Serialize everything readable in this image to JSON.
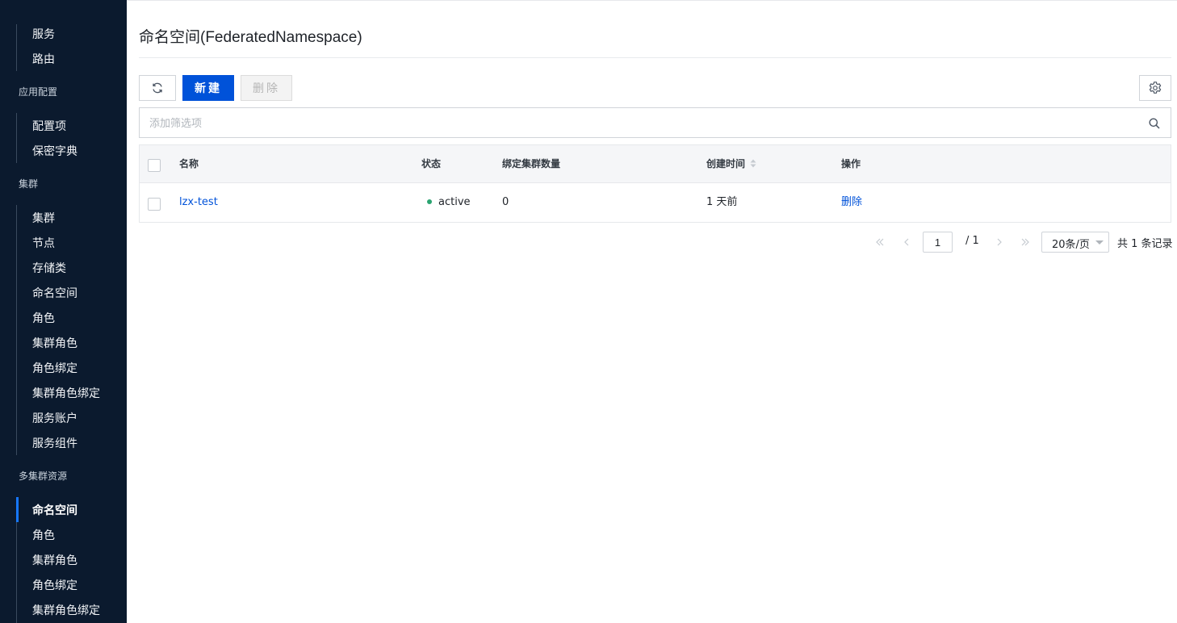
{
  "sidebar": {
    "top_items": [
      "服务",
      "路由"
    ],
    "groups": [
      {
        "label": "应用配置",
        "items": [
          "配置项",
          "保密字典"
        ]
      },
      {
        "label": "集群",
        "items": [
          "集群",
          "节点",
          "存储类",
          "命名空间",
          "角色",
          "集群角色",
          "角色绑定",
          "集群角色绑定",
          "服务账户",
          "服务组件"
        ]
      },
      {
        "label": "多集群资源",
        "items": [
          "命名空间",
          "角色",
          "集群角色",
          "角色绑定",
          "集群角色绑定"
        ]
      }
    ],
    "active_item": "命名空间"
  },
  "page": {
    "title": "命名空间(FederatedNamespace)"
  },
  "toolbar": {
    "refresh_icon": "refresh-icon",
    "new_label": "新建",
    "delete_label": "删除",
    "settings_icon": "gear-icon"
  },
  "filter": {
    "placeholder": "添加筛选项",
    "value": "",
    "icon": "search-icon"
  },
  "table": {
    "columns": [
      "名称",
      "状态",
      "绑定集群数量",
      "创建时间",
      "操作"
    ],
    "rows": [
      {
        "name": "lzx-test",
        "status": "active",
        "bound_clusters": "0",
        "created": "1 天前",
        "action": "删除"
      }
    ]
  },
  "pagination": {
    "current_page": "1",
    "total_pages_label": "/ 1",
    "page_size_label": "20条/页",
    "total_label": "共 1 条记录"
  },
  "colors": {
    "sidebar_bg": "#0b1a2e",
    "primary": "#0052d9",
    "status_active": "#2ba471"
  }
}
